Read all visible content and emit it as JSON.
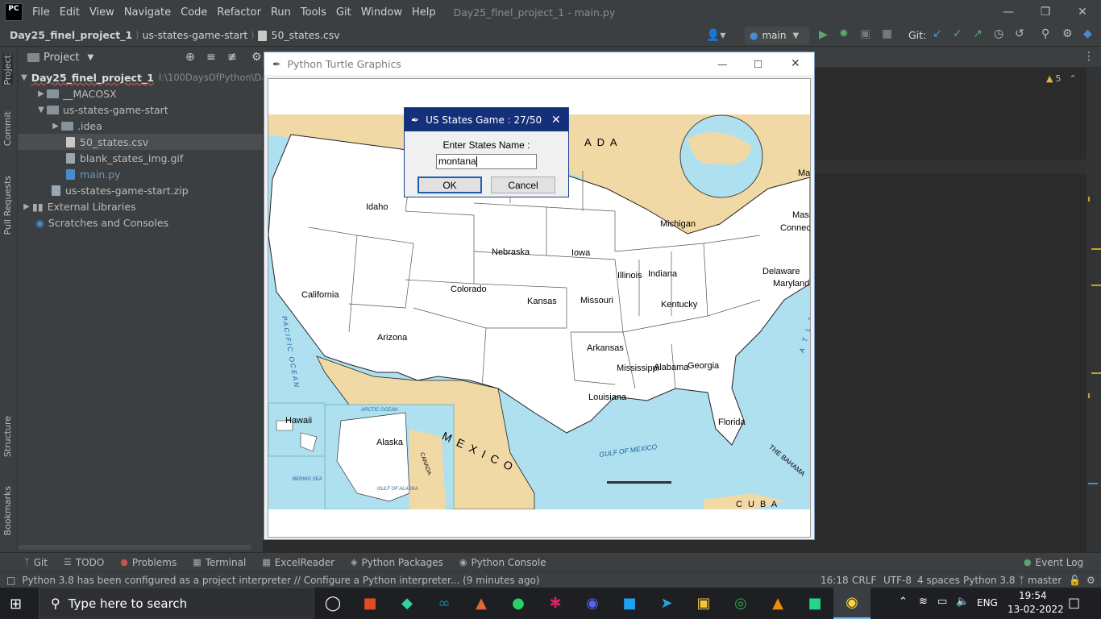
{
  "menubar": {
    "logo": "PC",
    "items": [
      "File",
      "Edit",
      "View",
      "Navigate",
      "Code",
      "Refactor",
      "Run",
      "Tools",
      "Git",
      "Window",
      "Help"
    ],
    "window_title": "Day25_finel_project_1 - main.py"
  },
  "navbar": {
    "crumbs": [
      "Day25_finel_project_1",
      "us-states-game-start",
      "50_states.csv"
    ],
    "branch": "main",
    "git_label": "Git:"
  },
  "left_strip": {
    "tabs": [
      "Project",
      "Commit",
      "Pull Requests",
      "Structure",
      "Bookmarks"
    ]
  },
  "project_panel": {
    "header": "Project",
    "tree": [
      {
        "label": "Day25_finel_project_1",
        "extra": "I:\\100DaysOfPython\\Day2"
      },
      {
        "label": "__MACOSX"
      },
      {
        "label": "us-states-game-start"
      },
      {
        "label": ".idea"
      },
      {
        "label": "50_states.csv"
      },
      {
        "label": "blank_states_img.gif"
      },
      {
        "label": "main.py"
      },
      {
        "label": "us-states-game-start.zip"
      },
      {
        "label": "External Libraries"
      },
      {
        "label": "Scratches and Consoles"
      }
    ]
  },
  "editor": {
    "warnings": "5"
  },
  "turtle_window": {
    "title": "Python Turtle Graphics",
    "map_labels": {
      "canada": "A D A",
      "mexico": "M E X I C O",
      "cuba": "C U B A",
      "gulf": "GULF OF MEXICO",
      "pacific": "PACIFIC OCEAN",
      "atlantic": "A T L A N",
      "bahamas": "THE BAHAMA",
      "canada_small": "CANADA",
      "arctic": "ARCTIC OCEAN",
      "gulf_alaska": "GULF OF ALASKA",
      "bering": "BERING SEA"
    },
    "states": [
      {
        "name": "Idaho"
      },
      {
        "name": "Nebraska"
      },
      {
        "name": "Iowa"
      },
      {
        "name": "Michigan"
      },
      {
        "name": "Illinois"
      },
      {
        "name": "Indiana"
      },
      {
        "name": "California"
      },
      {
        "name": "Colorado"
      },
      {
        "name": "Kansas"
      },
      {
        "name": "Missouri"
      },
      {
        "name": "Kentucky"
      },
      {
        "name": "Arizona"
      },
      {
        "name": "Arkansas"
      },
      {
        "name": "Mississippi"
      },
      {
        "name": "Alabama"
      },
      {
        "name": "Georgia"
      },
      {
        "name": "Louisiana"
      },
      {
        "name": "Florida"
      },
      {
        "name": "Hawaii"
      },
      {
        "name": "Alaska"
      },
      {
        "name": "Delaware"
      },
      {
        "name": "Maryland"
      },
      {
        "name": "Mass"
      },
      {
        "name": "Connec"
      },
      {
        "name": "Ma"
      }
    ]
  },
  "dialog": {
    "title": "US States Game : 27/50",
    "prompt": "Enter States Name :",
    "input_value": "montana",
    "ok": "OK",
    "cancel": "Cancel"
  },
  "bottom_tabs": [
    "Git",
    "TODO",
    "Problems",
    "Terminal",
    "ExcelReader",
    "Python Packages",
    "Python Console"
  ],
  "event_log": "Event Log",
  "status": {
    "message": "Python 3.8 has been configured as a project interpreter // Configure a Python interpreter... (9 minutes ago)",
    "position": "16:18",
    "line_sep": "CRLF",
    "encoding": "UTF-8",
    "indent": "4 spaces",
    "interpreter": "Python 3.8",
    "branch": "master"
  },
  "taskbar": {
    "search_placeholder": "Type here to search",
    "lang": "ENG",
    "time": "19:54",
    "date": "13-02-2022"
  },
  "colors": {
    "ide_bg": "#2b2b2b",
    "panel": "#3c3f41",
    "dialog_title": "#14307a",
    "ocean": "#aee0ef",
    "land_foreign": "#f1d9a6"
  }
}
